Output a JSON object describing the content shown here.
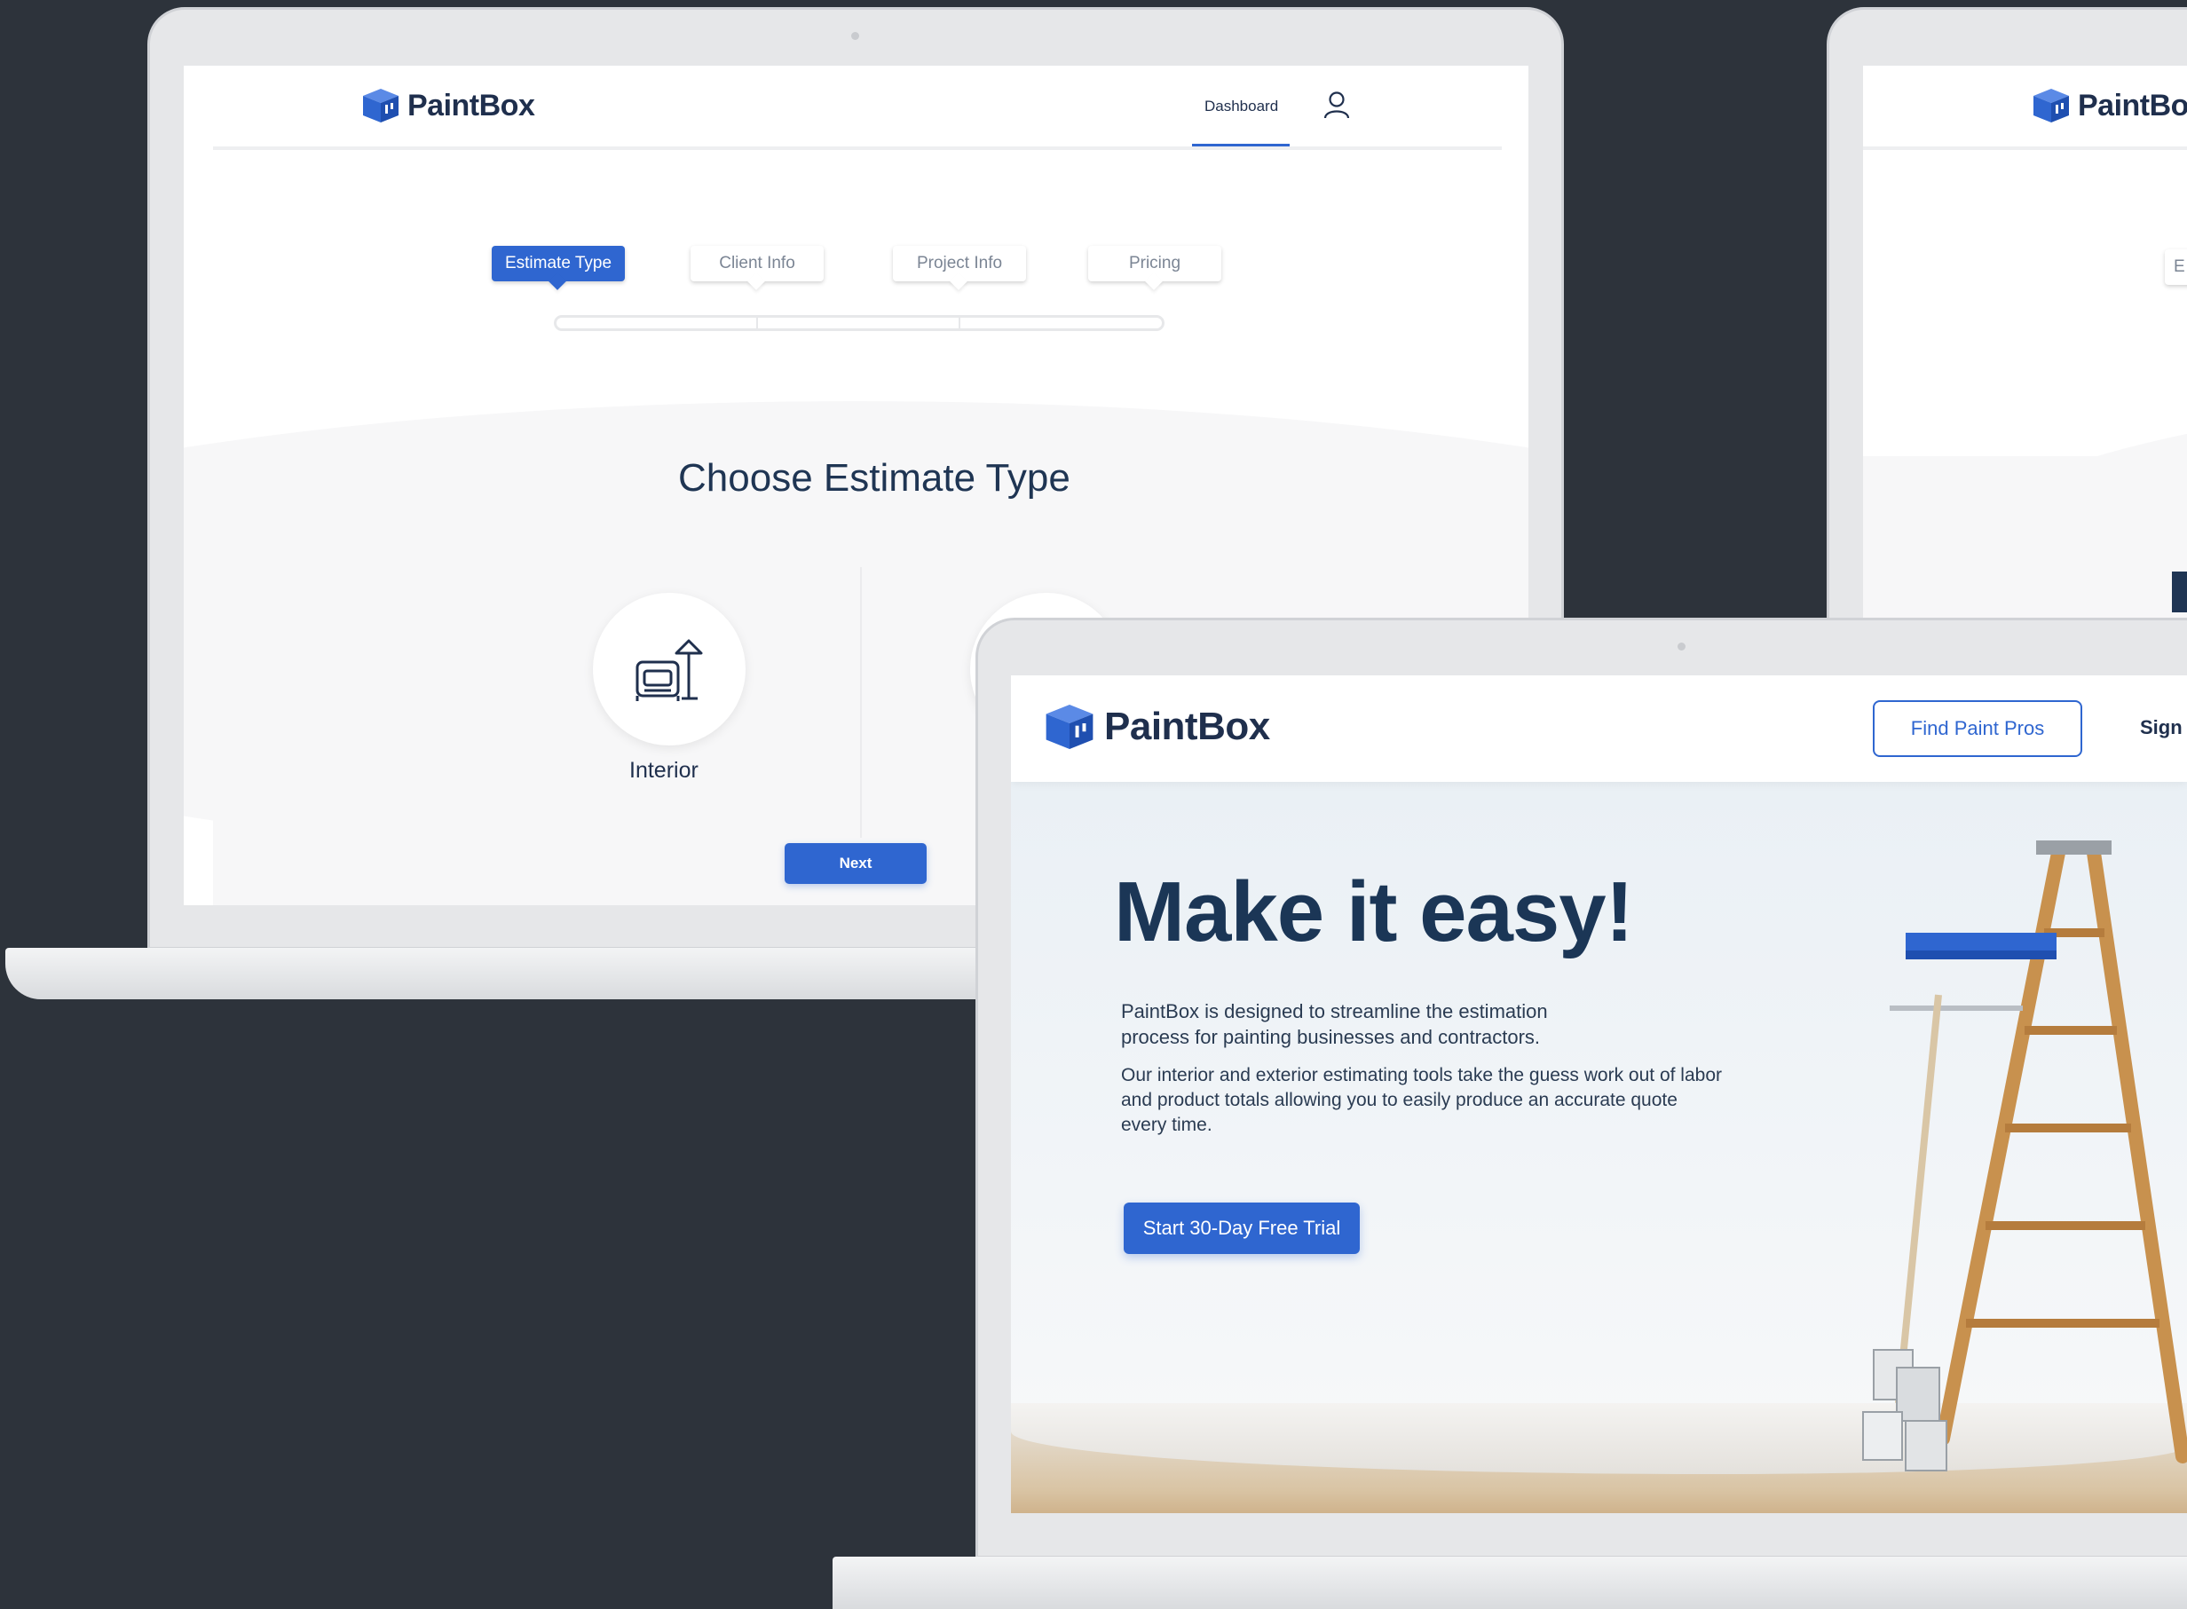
{
  "brand": {
    "name": "PaintBox",
    "accent": "#2f66d0",
    "navy": "#1f2f4d"
  },
  "estimate_screen": {
    "nav": {
      "dashboard_label": "Dashboard",
      "user_icon": "user-icon"
    },
    "steps": [
      {
        "label": "Estimate Type",
        "active": true
      },
      {
        "label": "Client Info",
        "active": false
      },
      {
        "label": "Project Info",
        "active": false
      },
      {
        "label": "Pricing",
        "active": false
      }
    ],
    "title": "Choose Estimate Type",
    "options": [
      {
        "label": "Interior",
        "icon": "armchair-lamp-icon"
      }
    ],
    "next_label": "Next"
  },
  "back_screen": {
    "stub_step_letter": "E"
  },
  "landing": {
    "find_pros_label": "Find Paint Pros",
    "sign_label": "Sign I",
    "headline": "Make it easy!",
    "paragraph_1_line_1": "PaintBox is designed to streamline the estimation",
    "paragraph_1_line_2": "process for painting businesses and contractors.",
    "paragraph_2_line_1": "Our interior and exterior estimating tools take the guess work out of labor",
    "paragraph_2_line_2": "and product totals allowing you to easily produce an accurate quote",
    "paragraph_2_line_3": "every time.",
    "cta_label": "Start 30-Day Free Trial"
  }
}
